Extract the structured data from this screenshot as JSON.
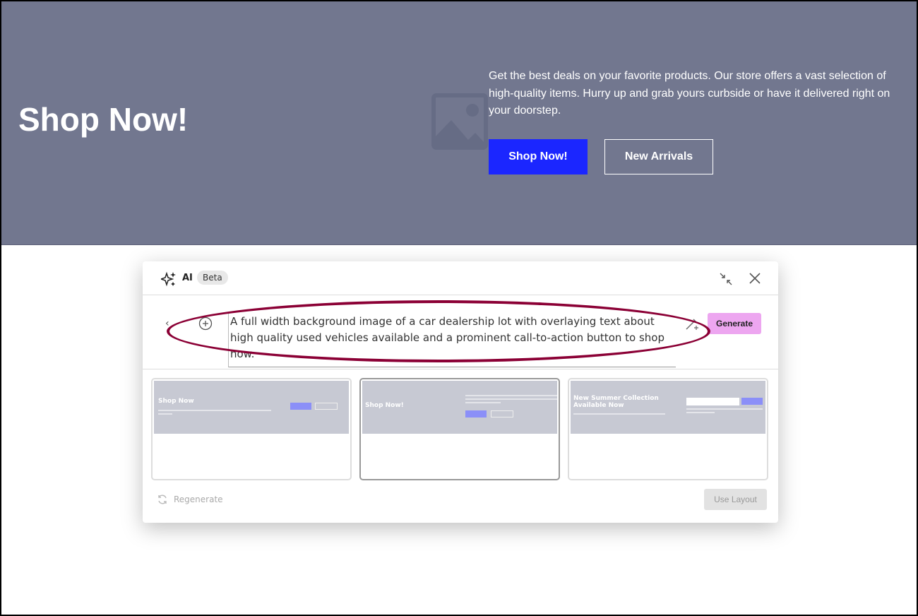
{
  "hero": {
    "title": "Shop Now!",
    "description": "Get the best deals on your favorite products. Our store offers a vast selection of high-quality items. Hurry up and grab yours curbside or have it delivered right on your doorstep.",
    "primary_button": "Shop Now!",
    "secondary_button": "New Arrivals",
    "colors": {
      "background": "#72778f",
      "primary": "#1b26ff"
    }
  },
  "modal": {
    "title": "AI",
    "badge": "Beta",
    "prompt": "A full width background image of a car dealership lot with overlaying text about high quality used vehicles available and a prominent call-to-action button to shop now.",
    "generate_label": "Generate",
    "regenerate_label": "Regenerate",
    "use_layout_label": "Use Layout",
    "layouts": [
      {
        "title": "Shop Now",
        "selected": false
      },
      {
        "title": "Shop Now!",
        "selected": true
      },
      {
        "title": "New Summer Collection Available Now",
        "selected": false
      }
    ],
    "colors": {
      "generate": "#eda6f0",
      "annotation": "#8b0035"
    }
  }
}
